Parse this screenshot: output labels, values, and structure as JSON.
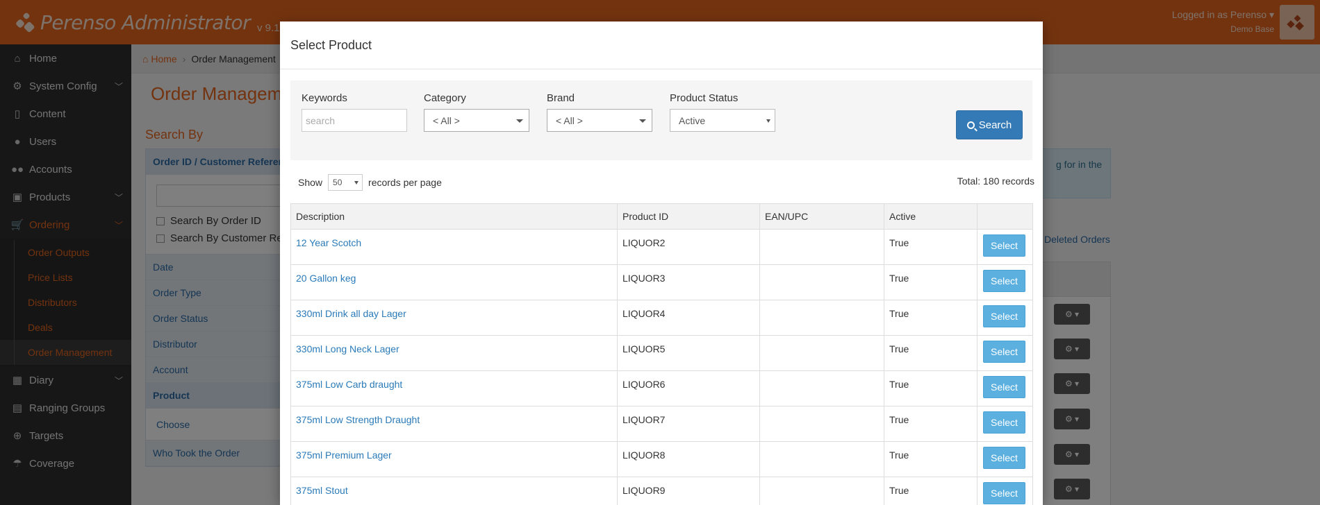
{
  "app": {
    "brand": "Perenso Administrator",
    "version": "v 9.1",
    "user_line": "Logged in as Perenso",
    "user_sub": "Demo Base"
  },
  "sidebar": {
    "items": [
      {
        "label": "Home",
        "icon": "home-icon"
      },
      {
        "label": "System Config",
        "icon": "gear-icon"
      },
      {
        "label": "Content",
        "icon": "file-icon"
      },
      {
        "label": "Users",
        "icon": "user-icon"
      },
      {
        "label": "Accounts",
        "icon": "users-icon"
      },
      {
        "label": "Products",
        "icon": "gift-icon"
      },
      {
        "label": "Ordering",
        "icon": "cart-icon"
      },
      {
        "label": "Diary",
        "icon": "calendar-icon"
      },
      {
        "label": "Ranging Groups",
        "icon": "cubes-icon"
      },
      {
        "label": "Targets",
        "icon": "crosshairs-icon"
      },
      {
        "label": "Coverage",
        "icon": "umbrella-icon"
      }
    ],
    "ordering_sub": [
      "Order Outputs",
      "Price Lists",
      "Distributors",
      "Deals",
      "Order Management"
    ]
  },
  "page": {
    "breadcrumb_home": "Home",
    "breadcrumb_current": "Order Management",
    "title": "Order Management",
    "search_by": "Search By",
    "filter_head": "Order ID / Customer Reference",
    "chk_order_id": "Search By Order ID",
    "chk_customer_ref": "Search By Customer Reference",
    "filter_rows": [
      "Date",
      "Order Type",
      "Order Status",
      "Distributor",
      "Account"
    ],
    "filter_product": "Product",
    "filter_choose": "Choose",
    "filter_who": "Who Took the Order",
    "info_text": "g for in the",
    "deleted_link": "w Deleted Orders"
  },
  "modal": {
    "title": "Select Product",
    "filters": {
      "keywords_label": "Keywords",
      "keywords_placeholder": "search",
      "category_label": "Category",
      "category_value": "< All >",
      "brand_label": "Brand",
      "brand_value": "< All >",
      "status_label": "Product Status",
      "status_value": "Active",
      "search_button": "Search"
    },
    "show_label": "Show",
    "per_page_value": "50",
    "per_page_suffix": "records per page",
    "total": "Total: 180 records",
    "columns": [
      "Description",
      "Product ID",
      "EAN/UPC",
      "Active",
      ""
    ],
    "select_label": "Select",
    "rows": [
      {
        "desc": "12 Year Scotch",
        "pid": "LIQUOR2",
        "ean": "",
        "active": "True"
      },
      {
        "desc": "20 Gallon keg",
        "pid": "LIQUOR3",
        "ean": "",
        "active": "True"
      },
      {
        "desc": "330ml Drink all day Lager",
        "pid": "LIQUOR4",
        "ean": "",
        "active": "True"
      },
      {
        "desc": "330ml Long Neck Lager",
        "pid": "LIQUOR5",
        "ean": "",
        "active": "True"
      },
      {
        "desc": "375ml Low Carb draught",
        "pid": "LIQUOR6",
        "ean": "",
        "active": "True"
      },
      {
        "desc": "375ml Low Strength Draught",
        "pid": "LIQUOR7",
        "ean": "",
        "active": "True"
      },
      {
        "desc": "375ml Premium Lager",
        "pid": "LIQUOR8",
        "ean": "",
        "active": "True"
      },
      {
        "desc": "375ml Stout",
        "pid": "LIQUOR9",
        "ean": "",
        "active": "True"
      }
    ]
  },
  "colors": {
    "brand_orange": "#e8661f",
    "sidebar_bg": "#2f2f2f",
    "link_blue": "#2a7ab8",
    "primary_button": "#337ab7",
    "select_button": "#5bb0e0"
  }
}
